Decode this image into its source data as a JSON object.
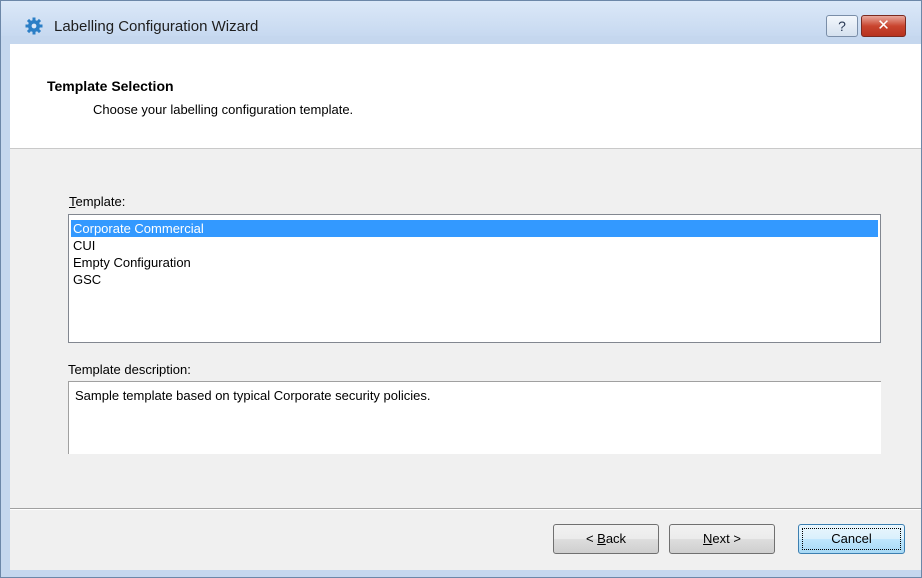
{
  "window": {
    "title": "Labelling Configuration Wizard",
    "icon": "gear-icon",
    "help_label": "?",
    "close_label": "✕"
  },
  "header": {
    "title": "Template Selection",
    "subtitle": "Choose your labelling configuration template."
  },
  "template": {
    "label_mnemonic": "T",
    "label_rest": "emplate:",
    "items": [
      "Corporate Commercial",
      "CUI",
      "Empty Configuration",
      "GSC"
    ],
    "selected_index": 0
  },
  "description": {
    "label": "Template description:",
    "text": "Sample template based on typical Corporate security policies."
  },
  "buttons": {
    "back_prefix": "< ",
    "back_mnemonic": "B",
    "back_rest": "ack",
    "next_mnemonic": "N",
    "next_rest": "ext >",
    "cancel": "Cancel"
  },
  "colors": {
    "selection": "#3399ff",
    "close_button": "#c9452f"
  }
}
